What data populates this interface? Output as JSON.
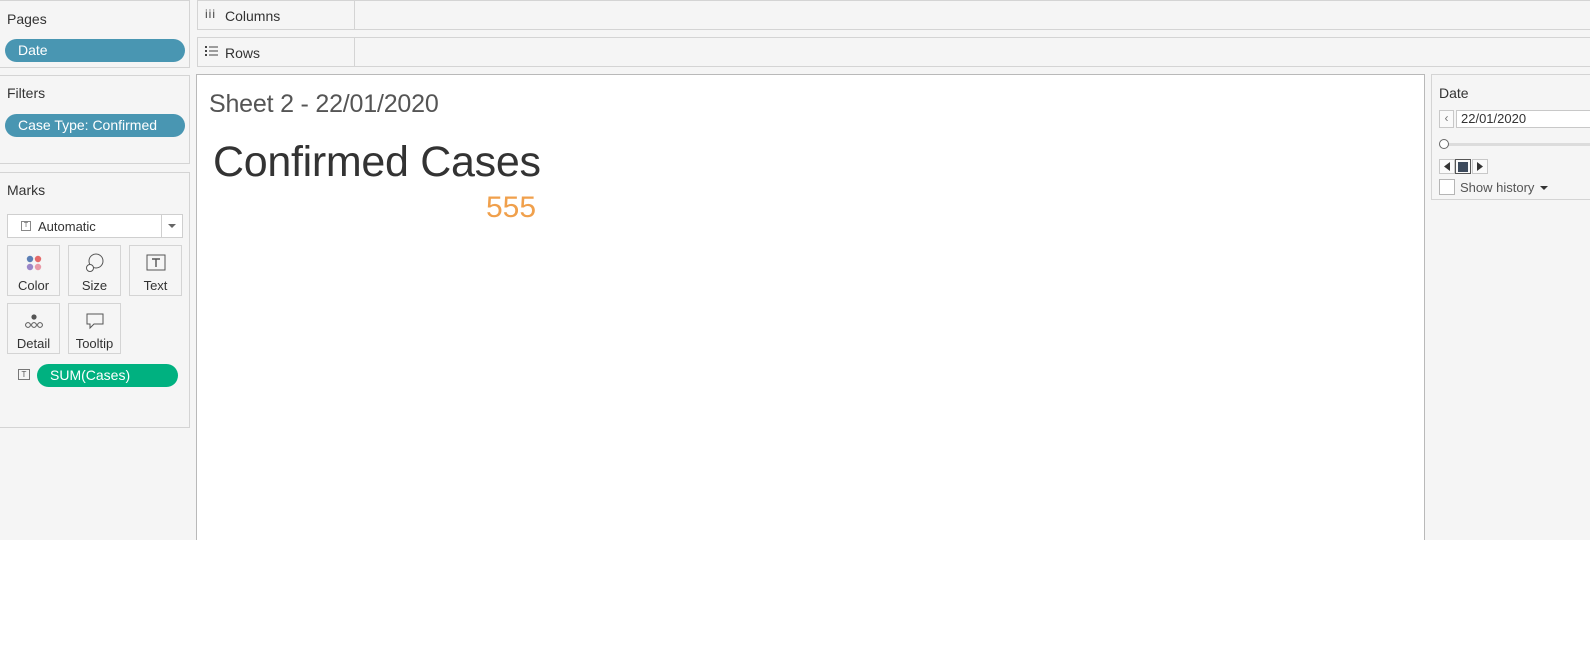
{
  "pages": {
    "title": "Pages",
    "pill": "Date"
  },
  "filters": {
    "title": "Filters",
    "pill": "Case Type: Confirmed"
  },
  "marks": {
    "title": "Marks",
    "type": "Automatic",
    "buttons": {
      "color": "Color",
      "size": "Size",
      "text": "Text",
      "detail": "Detail",
      "tooltip": "Tooltip"
    },
    "field": "SUM(Cases)"
  },
  "shelves": {
    "columns": "Columns",
    "rows": "Rows"
  },
  "canvas": {
    "sheet_title": "Sheet 2 - 22/01/2020",
    "viz_title": "Confirmed Cases",
    "value": "555"
  },
  "page_control": {
    "title": "Date",
    "current": "22/01/2020",
    "show_history": "Show history"
  },
  "colors": {
    "dimension_pill": "#4996b2",
    "measure_pill": "#00b180",
    "value_text": "#f0a04c"
  }
}
